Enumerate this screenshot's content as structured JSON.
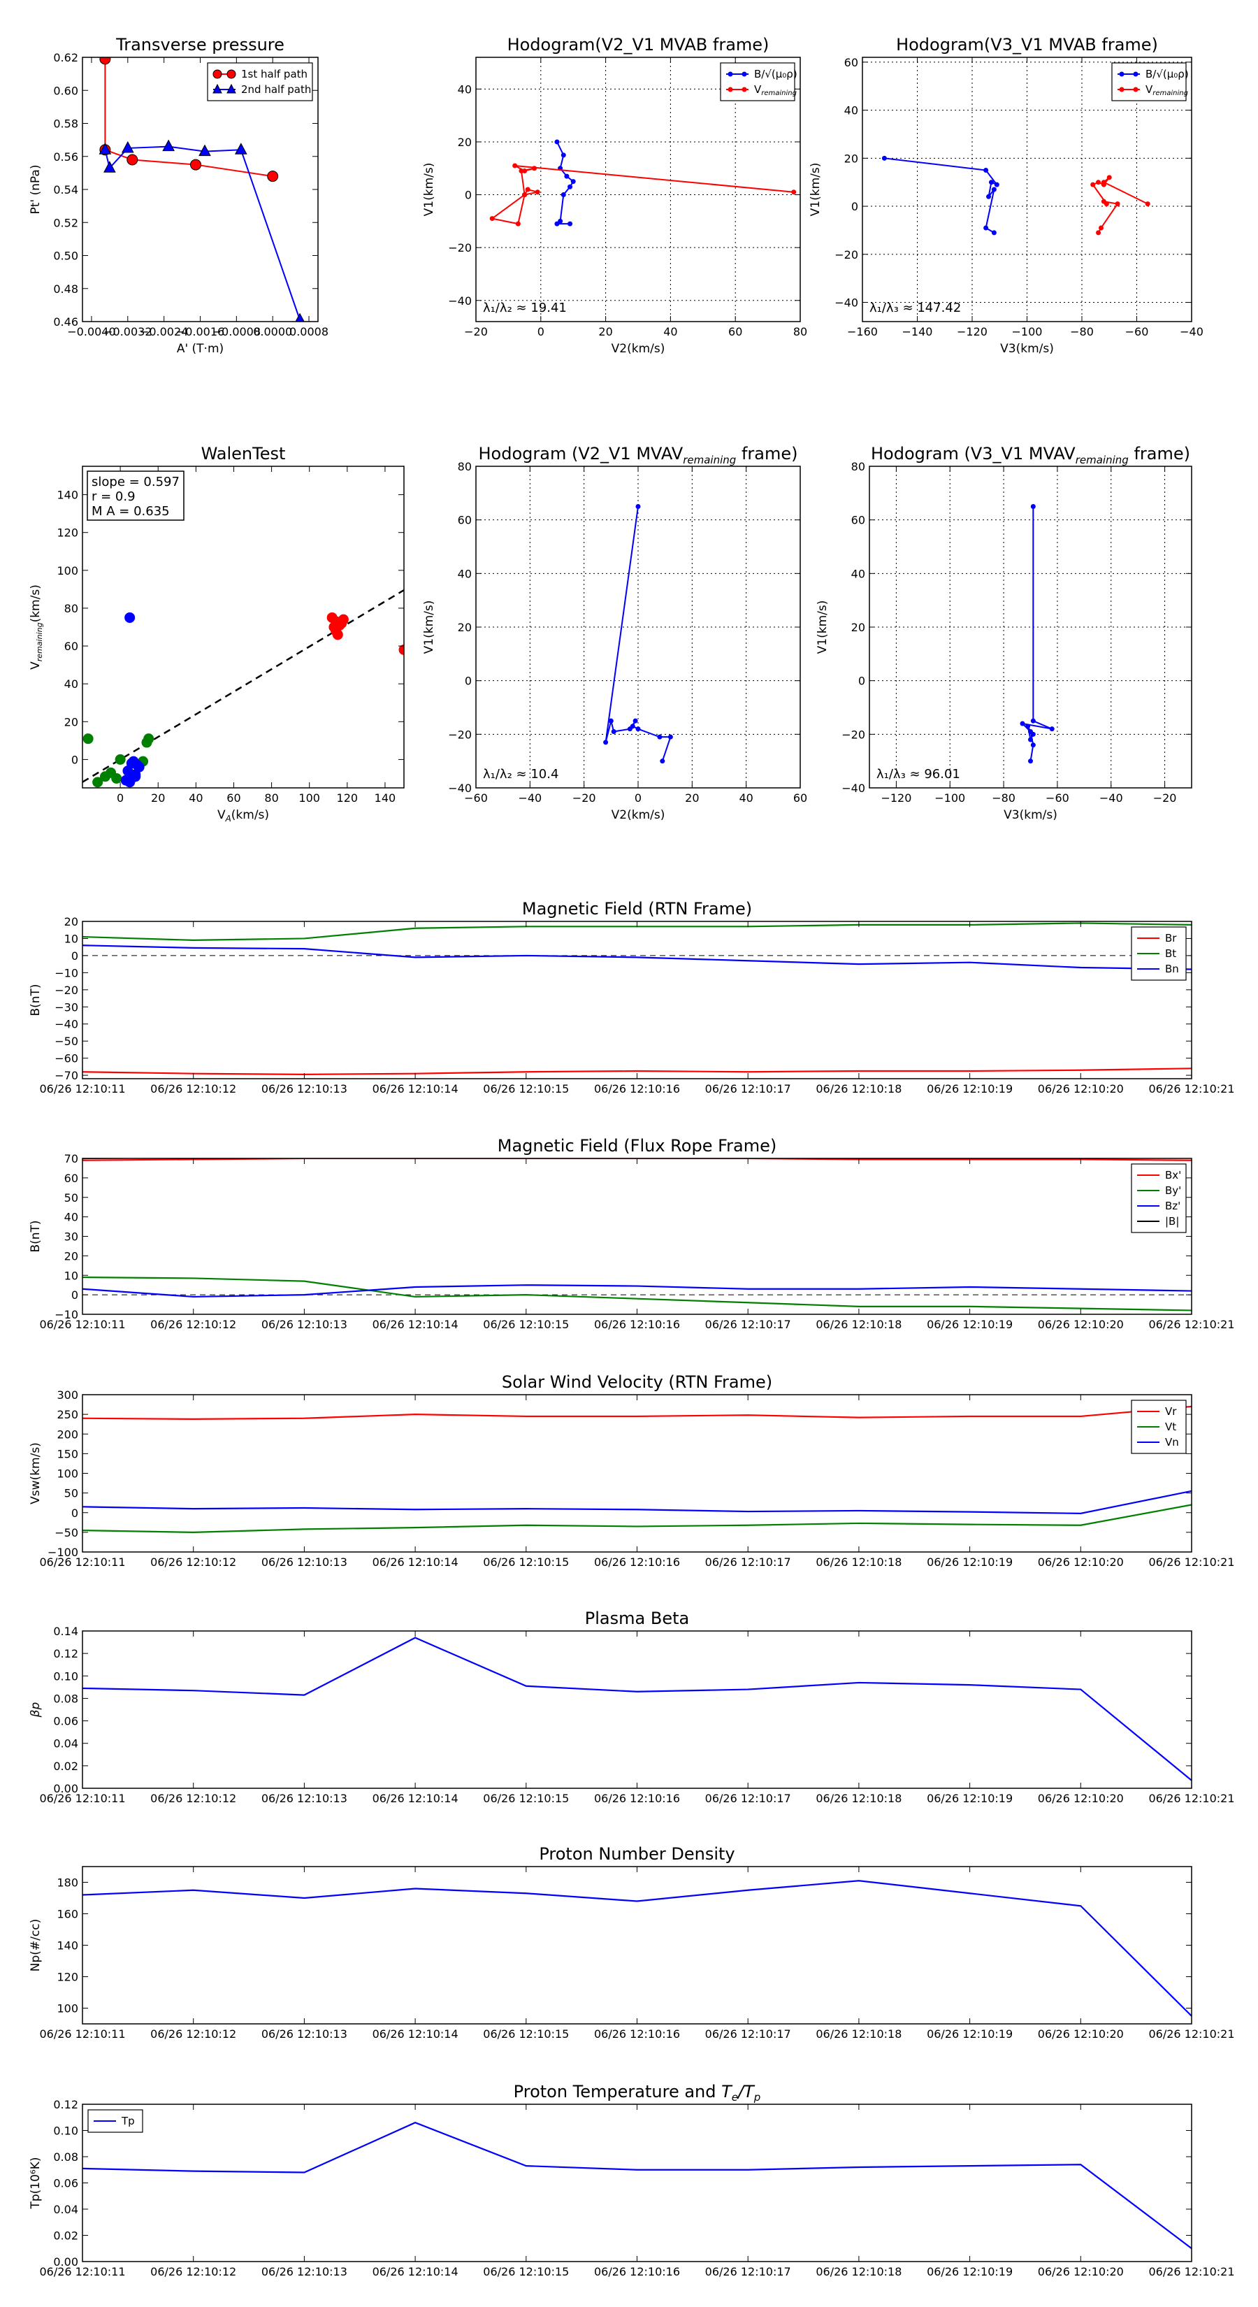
{
  "time_ticks": [
    "06/26 12:10:11",
    "06/26 12:10:12",
    "06/26 12:10:13",
    "06/26 12:10:14",
    "06/26 12:10:15",
    "06/26 12:10:16",
    "06/26 12:10:17",
    "06/26 12:10:18",
    "06/26 12:10:19",
    "06/26 12:10:20",
    "06/26 12:10:21"
  ],
  "chart_data": [
    {
      "id": "transverse_pressure",
      "type": "line",
      "title": "Transverse pressure",
      "xlabel": "A' (T·m)",
      "ylabel": "Pt' (nPa)",
      "xlim": [
        -0.0042,
        0.001
      ],
      "ylim": [
        0.46,
        0.62
      ],
      "xticks": [
        -0.004,
        -0.0032,
        -0.0024,
        -0.0016,
        -0.0008,
        0.0,
        0.0008
      ],
      "xtick_labels": [
        "−0.0040",
        "−0.0032",
        "−0.0024",
        "−0.0016",
        "−0.0008",
        "0.0000",
        "0.0008"
      ],
      "yticks": [
        0.46,
        0.48,
        0.5,
        0.52,
        0.54,
        0.56,
        0.58,
        0.6,
        0.62
      ],
      "ytick_labels": [
        "0.46",
        "0.48",
        "0.50",
        "0.52",
        "0.54",
        "0.56",
        "0.58",
        "0.60",
        "0.62"
      ],
      "legend_position": "top-right",
      "series": [
        {
          "name": "1st half path",
          "color": "#ff0000",
          "marker": "circle",
          "x": [
            0.0,
            -0.0017,
            -0.0031,
            -0.0037,
            -0.0037
          ],
          "y": [
            0.548,
            0.555,
            0.558,
            0.564,
            0.619
          ]
        },
        {
          "name": "2nd half path",
          "color": "#0000ff",
          "marker": "triangle",
          "x": [
            -0.0037,
            -0.0036,
            -0.0032,
            -0.0023,
            -0.0015,
            -0.0007,
            0.0006
          ],
          "y": [
            0.564,
            0.553,
            0.565,
            0.566,
            0.563,
            0.564,
            0.461
          ]
        }
      ]
    },
    {
      "id": "hodogram_v2v1_mvab",
      "type": "line",
      "title": "Hodogram(V2_V1 MVAB frame)",
      "xlabel": "V2(km/s)",
      "ylabel": "V1(km/s)",
      "xlim": [
        -20,
        80
      ],
      "ylim": [
        -48,
        52
      ],
      "xticks": [
        -20,
        0,
        20,
        40,
        60,
        80
      ],
      "yticks": [
        -40,
        -20,
        0,
        20,
        40
      ],
      "grid": true,
      "legend_position": "top-right",
      "annotation": "λ₁/λ₂ ≈ 19.41",
      "series": [
        {
          "name": "B/√(μ₀ρ)",
          "color": "#0000ff",
          "x": [
            5,
            7,
            6,
            8,
            10,
            9,
            7,
            6,
            5,
            9
          ],
          "y": [
            20,
            15,
            10,
            7,
            5,
            3,
            0,
            -10,
            -11,
            -11
          ]
        },
        {
          "name": "V remaining",
          "color": "#ff0000",
          "x": [
            78,
            -8,
            -5,
            -2,
            -6,
            -5,
            -4,
            -1,
            -5,
            -15,
            -7,
            -5
          ],
          "y": [
            1,
            11,
            9,
            10,
            9,
            0,
            2,
            1,
            0,
            -9,
            -11,
            0
          ]
        }
      ]
    },
    {
      "id": "hodogram_v3v1_mvab",
      "type": "line",
      "title": "Hodogram(V3_V1 MVAB frame)",
      "xlabel": "V3(km/s)",
      "ylabel": "V1(km/s)",
      "xlim": [
        -160,
        -40
      ],
      "ylim": [
        -48,
        62
      ],
      "xticks": [
        -160,
        -140,
        -120,
        -100,
        -80,
        -60,
        -40
      ],
      "yticks": [
        -40,
        -20,
        0,
        20,
        40,
        60
      ],
      "grid": true,
      "legend_position": "top-right",
      "annotation": "λ₁/λ₃ ≈ 147.42",
      "series": [
        {
          "name": "B/√(μ₀ρ)",
          "color": "#0000ff",
          "x": [
            -152,
            -115,
            -111,
            -113,
            -114,
            -112,
            -115,
            -112
          ],
          "y": [
            20,
            15,
            9,
            10,
            4,
            7,
            -9,
            -11
          ]
        },
        {
          "name": "V remaining",
          "color": "#ff0000",
          "x": [
            -56,
            -72,
            -70,
            -72,
            -74,
            -76,
            -71,
            -72,
            -67,
            -73,
            -74
          ],
          "y": [
            1,
            10,
            12,
            9,
            10,
            9,
            1,
            2,
            1,
            -9,
            -11
          ]
        }
      ]
    },
    {
      "id": "walen_test",
      "type": "scatter",
      "title": "WalenTest",
      "xlabel": "V A (km/s)",
      "ylabel": "V remaining (km/s)",
      "xlim": [
        -20,
        150
      ],
      "ylim": [
        -15,
        155
      ],
      "xticks": [
        0,
        20,
        40,
        60,
        80,
        100,
        120,
        140
      ],
      "yticks": [
        0,
        20,
        40,
        60,
        80,
        100,
        120,
        140
      ],
      "annotations": [
        "slope = 0.597",
        "r = 0.9",
        "M A = 0.635"
      ],
      "fit_line": {
        "slope": 0.597,
        "intercept": 0,
        "color": "#000000",
        "style": "dashed"
      },
      "series": [
        {
          "color": "#ff0000",
          "x": [
            112,
            114,
            116,
            113,
            115,
            117,
            114,
            118,
            150
          ],
          "y": [
            75,
            73,
            71,
            70,
            66,
            72,
            68,
            74,
            58
          ]
        },
        {
          "color": "#008000",
          "x": [
            -17,
            -12,
            -8,
            -5,
            -2,
            0,
            12,
            14,
            15
          ],
          "y": [
            11,
            -12,
            -9,
            -7,
            -10,
            0,
            -1,
            9,
            11
          ]
        },
        {
          "color": "#0000ff",
          "x": [
            5,
            3,
            6,
            8,
            9,
            10,
            4,
            7,
            8,
            5,
            6
          ],
          "y": [
            75,
            -11,
            -10,
            -8,
            -3,
            -4,
            -6,
            -1,
            -9,
            -12,
            -2
          ]
        }
      ]
    },
    {
      "id": "hodogram_v2v1_mvav",
      "type": "line",
      "title": "Hodogram (V2_V1 MVAV remaining frame)",
      "xlabel": "V2(km/s)",
      "ylabel": "V1(km/s)",
      "xlim": [
        -60,
        60
      ],
      "ylim": [
        -40,
        80
      ],
      "xticks": [
        -60,
        -40,
        -20,
        0,
        20,
        40,
        60
      ],
      "yticks": [
        -40,
        -20,
        0,
        20,
        40,
        60,
        80
      ],
      "grid": true,
      "annotation": "λ₁/λ₂ ≈ 10.4",
      "series": [
        {
          "color": "#0000ff",
          "x": [
            0,
            -12,
            -10,
            -9,
            -3,
            -1,
            -2,
            0,
            8,
            12,
            9
          ],
          "y": [
            65,
            -23,
            -15,
            -19,
            -18,
            -15,
            -17,
            -18,
            -21,
            -21,
            -30
          ]
        }
      ]
    },
    {
      "id": "hodogram_v3v1_mvav",
      "type": "line",
      "title": "Hodogram (V3_V1 MVAV remaining frame)",
      "xlabel": "V3(km/s)",
      "ylabel": "V1(km/s)",
      "xlim": [
        -130,
        -10
      ],
      "ylim": [
        -40,
        80
      ],
      "xticks": [
        -120,
        -100,
        -80,
        -60,
        -40,
        -20
      ],
      "yticks": [
        -40,
        -20,
        0,
        20,
        40,
        60,
        80
      ],
      "grid": true,
      "annotation": "λ₁/λ₃ ≈ 96.01",
      "series": [
        {
          "color": "#0000ff",
          "x": [
            -69,
            -69,
            -62,
            -73,
            -69,
            -70,
            -71,
            -70,
            -69,
            -70
          ],
          "y": [
            65,
            -15,
            -18,
            -16,
            -20,
            -22,
            -17,
            -19,
            -24,
            -30
          ]
        }
      ]
    },
    {
      "id": "mag_rtn",
      "type": "line",
      "title": "Magnetic Field (RTN Frame)",
      "ylabel": "B(nT)",
      "ylim": [
        -72,
        20
      ],
      "yticks": [
        -70,
        -60,
        -50,
        -40,
        -30,
        -20,
        -10,
        0,
        10,
        20
      ],
      "zero_line": true,
      "legend_position": "top-right",
      "series": [
        {
          "name": "Br",
          "color": "#ff0000",
          "values": [
            -68,
            -69,
            -69.5,
            -69,
            -68,
            -67.5,
            -68,
            -67.5,
            -67.5,
            -67,
            -66
          ]
        },
        {
          "name": "Bt",
          "color": "#008000",
          "values": [
            11,
            9,
            10,
            16,
            17,
            17,
            17,
            18,
            18,
            19,
            18
          ]
        },
        {
          "name": "Bn",
          "color": "#0000ff",
          "values": [
            6,
            4.5,
            4,
            -1,
            0,
            -1,
            -3,
            -5,
            -4,
            -7,
            -8
          ]
        }
      ]
    },
    {
      "id": "mag_fluxrope",
      "type": "line",
      "title": "Magnetic Field (Flux Rope Frame)",
      "ylabel": "B(nT)",
      "ylim": [
        -10,
        70
      ],
      "yticks": [
        -10,
        0,
        10,
        20,
        30,
        40,
        50,
        60,
        70
      ],
      "zero_line": true,
      "legend_position": "top-right",
      "series": [
        {
          "name": "Bx'",
          "color": "#ff0000",
          "values": [
            69,
            69.5,
            70,
            70,
            70,
            70,
            70,
            69.5,
            69.5,
            69.5,
            69
          ]
        },
        {
          "name": "By'",
          "color": "#008000",
          "values": [
            9,
            8.5,
            7,
            -1,
            0,
            -2,
            -4,
            -6,
            -6,
            -7,
            -8
          ]
        },
        {
          "name": "Bz'",
          "color": "#0000ff",
          "values": [
            3,
            -1,
            0,
            4,
            5,
            4.5,
            3,
            3,
            4,
            3,
            2
          ]
        },
        {
          "name": "|B|",
          "color": "#000000",
          "values": [
            70,
            70.5,
            71,
            71,
            71,
            71,
            71,
            71,
            71,
            71,
            71
          ]
        }
      ]
    },
    {
      "id": "sw_velocity",
      "type": "line",
      "title": "Solar Wind Velocity (RTN Frame)",
      "ylabel": "Vsw(km/s)",
      "ylim": [
        -100,
        300
      ],
      "yticks": [
        -100,
        -50,
        0,
        50,
        100,
        150,
        200,
        250,
        300
      ],
      "legend_position": "top-right",
      "series": [
        {
          "name": "Vr",
          "color": "#ff0000",
          "values": [
            240,
            238,
            240,
            250,
            245,
            245,
            248,
            242,
            245,
            245,
            270
          ]
        },
        {
          "name": "Vt",
          "color": "#008000",
          "values": [
            -45,
            -50,
            -42,
            -38,
            -32,
            -35,
            -32,
            -27,
            -30,
            -32,
            20
          ]
        },
        {
          "name": "Vn",
          "color": "#0000ff",
          "values": [
            15,
            10,
            12,
            8,
            10,
            8,
            3,
            5,
            2,
            -2,
            55
          ]
        }
      ]
    },
    {
      "id": "plasma_beta",
      "type": "line",
      "title": "Plasma Beta",
      "ylabel": "βp",
      "ylim": [
        0.0,
        0.14
      ],
      "yticks": [
        0.0,
        0.02,
        0.04,
        0.06,
        0.08,
        0.1,
        0.12,
        0.14
      ],
      "ytick_labels": [
        "0.00",
        "0.02",
        "0.04",
        "0.06",
        "0.08",
        "0.10",
        "0.12",
        "0.14"
      ],
      "series": [
        {
          "color": "#0000ff",
          "values": [
            0.089,
            0.087,
            0.083,
            0.134,
            0.091,
            0.086,
            0.088,
            0.094,
            0.092,
            0.088,
            0.007
          ]
        }
      ]
    },
    {
      "id": "proton_density",
      "type": "line",
      "title": "Proton Number Density",
      "ylabel": "Np(#/cc)",
      "ylim": [
        90,
        190
      ],
      "yticks": [
        100,
        120,
        140,
        160,
        180
      ],
      "series": [
        {
          "color": "#0000ff",
          "values": [
            172,
            175,
            170,
            176,
            173,
            168,
            175,
            181,
            173,
            165,
            95
          ]
        }
      ]
    },
    {
      "id": "proton_temp",
      "type": "line",
      "title": "Proton Temperature and Te/Tp",
      "ylabel": "Tp(10⁶K)",
      "ylim": [
        0.0,
        0.12
      ],
      "yticks": [
        0.0,
        0.02,
        0.04,
        0.06,
        0.08,
        0.1,
        0.12
      ],
      "ytick_labels": [
        "0.00",
        "0.02",
        "0.04",
        "0.06",
        "0.08",
        "0.10",
        "0.12"
      ],
      "legend_position": "top-left",
      "series": [
        {
          "name": "Tp",
          "color": "#0000ff",
          "values": [
            0.071,
            0.069,
            0.068,
            0.106,
            0.073,
            0.07,
            0.07,
            0.072,
            0.073,
            0.074,
            0.01
          ]
        }
      ]
    }
  ]
}
